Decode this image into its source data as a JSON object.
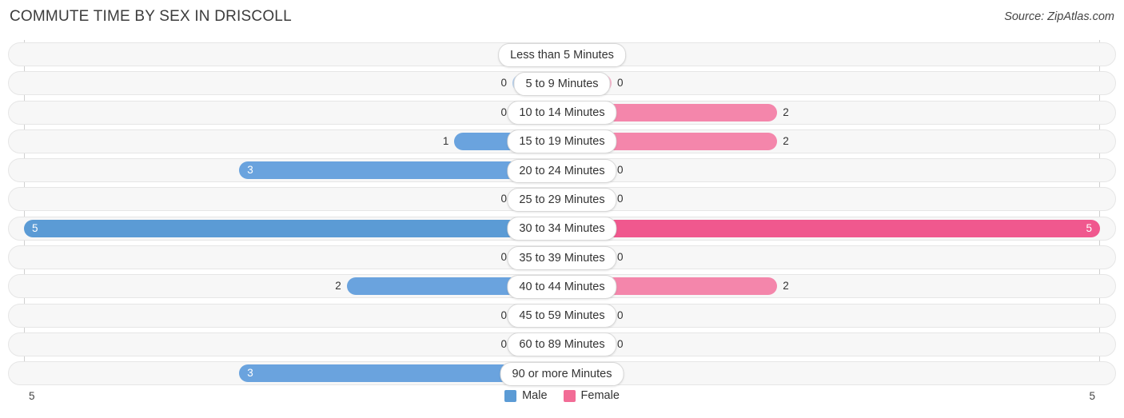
{
  "header": {
    "title": "COMMUTE TIME BY SEX IN DRISCOLL",
    "source": "Source: ZipAtlas.com"
  },
  "axis": {
    "left_tick": "5",
    "right_tick": "5",
    "max": 5
  },
  "legend": {
    "items": [
      {
        "label": "Male",
        "color": "#5b9bd5"
      },
      {
        "label": "Female",
        "color": "#f26c96"
      }
    ]
  },
  "colors": {
    "male_zero": "#aecbec",
    "male_value": "#6aa3de",
    "male_max": "#5b9bd5",
    "female_zero": "#f9aec9",
    "female_value": "#f486ab",
    "female_max": "#f0588e",
    "track_bg": "#f7f7f7",
    "track_border": "#e6e6e6"
  },
  "chart_data": {
    "type": "bar",
    "title": "COMMUTE TIME BY SEX IN DRISCOLL",
    "subtitle": "Source: ZipAtlas.com",
    "orientation": "horizontal-diverging",
    "xlabel": "",
    "ylabel": "",
    "xlim": [
      5,
      5
    ],
    "grid": false,
    "legend_position": "bottom-center",
    "categories": [
      "Less than 5 Minutes",
      "5 to 9 Minutes",
      "10 to 14 Minutes",
      "15 to 19 Minutes",
      "20 to 24 Minutes",
      "25 to 29 Minutes",
      "30 to 34 Minutes",
      "35 to 39 Minutes",
      "40 to 44 Minutes",
      "45 to 59 Minutes",
      "60 to 89 Minutes",
      "90 or more Minutes"
    ],
    "series": [
      {
        "name": "Male",
        "values": [
          0,
          0,
          0,
          1,
          3,
          0,
          5,
          0,
          2,
          0,
          0,
          3
        ]
      },
      {
        "name": "Female",
        "values": [
          0,
          0,
          2,
          2,
          0,
          0,
          5,
          0,
          2,
          0,
          0,
          0
        ]
      }
    ]
  },
  "rows": [
    {
      "label": "Less than 5 Minutes",
      "male": "0",
      "female": "0"
    },
    {
      "label": "5 to 9 Minutes",
      "male": "0",
      "female": "0"
    },
    {
      "label": "10 to 14 Minutes",
      "male": "0",
      "female": "2"
    },
    {
      "label": "15 to 19 Minutes",
      "male": "1",
      "female": "2"
    },
    {
      "label": "20 to 24 Minutes",
      "male": "3",
      "female": "0"
    },
    {
      "label": "25 to 29 Minutes",
      "male": "0",
      "female": "0"
    },
    {
      "label": "30 to 34 Minutes",
      "male": "5",
      "female": "5"
    },
    {
      "label": "35 to 39 Minutes",
      "male": "0",
      "female": "0"
    },
    {
      "label": "40 to 44 Minutes",
      "male": "2",
      "female": "2"
    },
    {
      "label": "45 to 59 Minutes",
      "male": "0",
      "female": "0"
    },
    {
      "label": "60 to 89 Minutes",
      "male": "0",
      "female": "0"
    },
    {
      "label": "90 or more Minutes",
      "male": "3",
      "female": "0"
    }
  ]
}
